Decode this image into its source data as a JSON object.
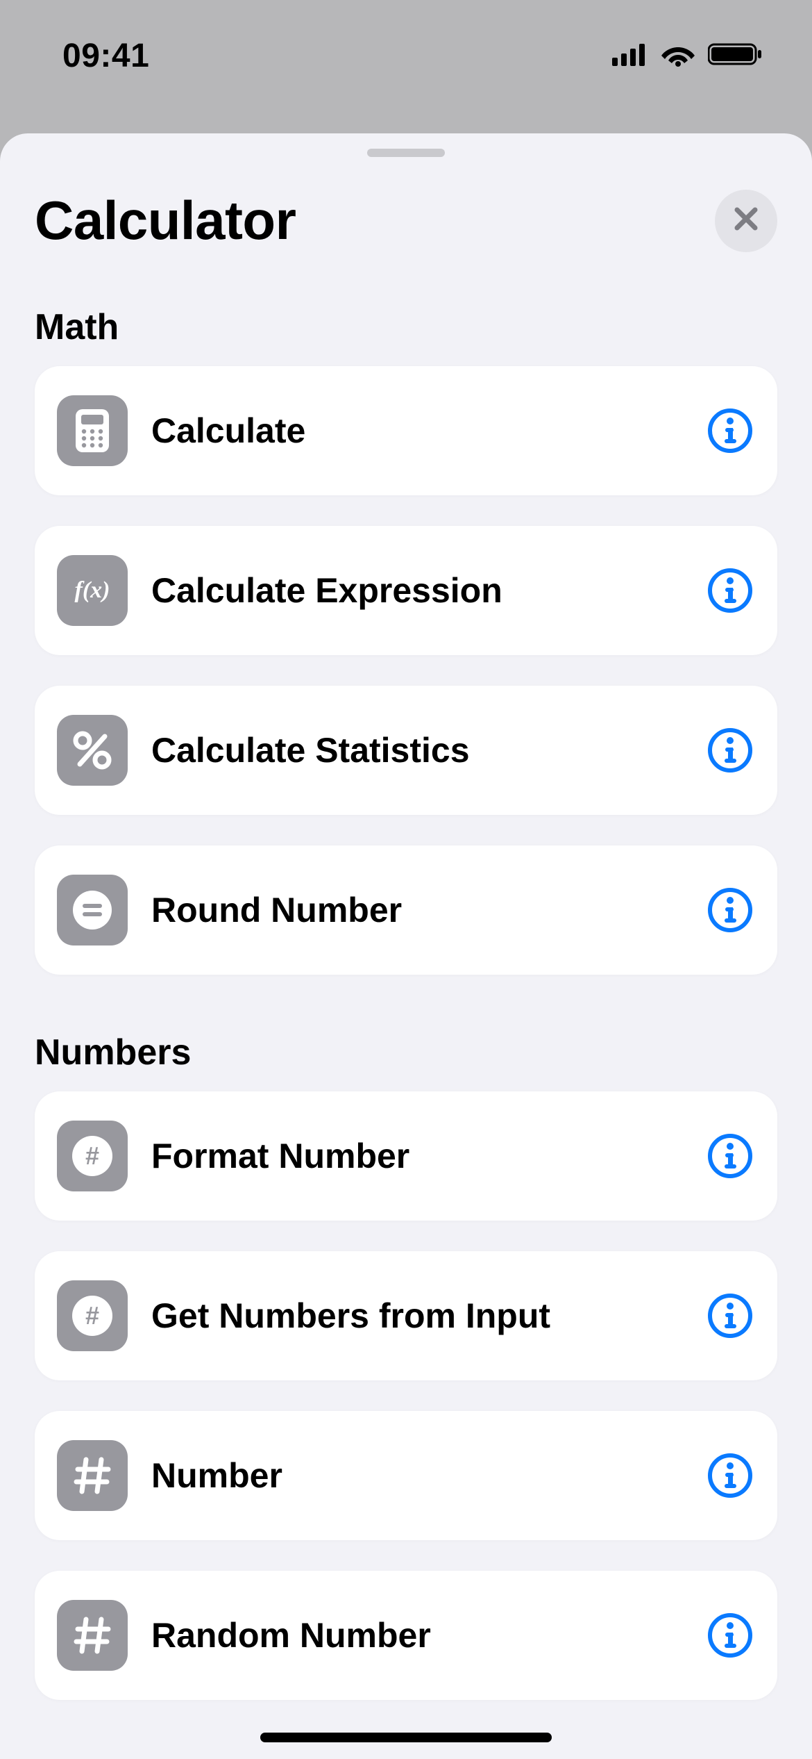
{
  "statusBar": {
    "time": "09:41"
  },
  "sheet": {
    "title": "Calculator",
    "sections": [
      {
        "title": "Math",
        "items": [
          {
            "label": "Calculate"
          },
          {
            "label": "Calculate Expression"
          },
          {
            "label": "Calculate Statistics"
          },
          {
            "label": "Round Number"
          }
        ]
      },
      {
        "title": "Numbers",
        "items": [
          {
            "label": "Format Number"
          },
          {
            "label": "Get Numbers from Input"
          },
          {
            "label": "Number"
          },
          {
            "label": "Random Number"
          }
        ]
      }
    ]
  }
}
